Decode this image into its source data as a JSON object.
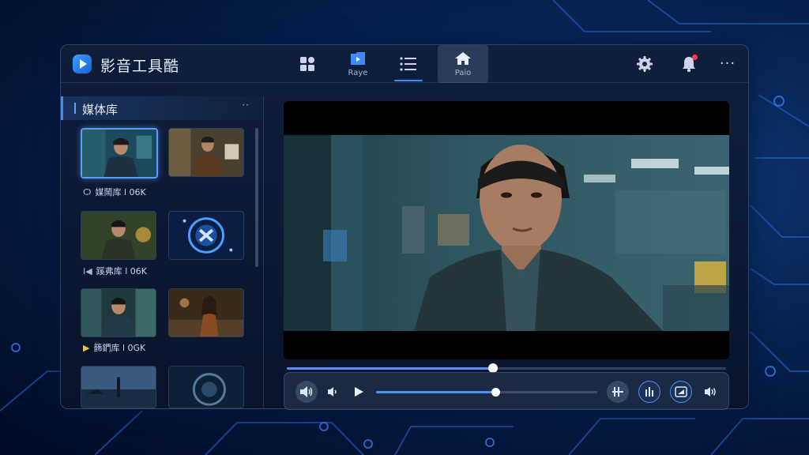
{
  "app": {
    "title": "影音工具酷"
  },
  "nav": [
    {
      "id": "grid",
      "label": ""
    },
    {
      "id": "player",
      "label": "Raye"
    },
    {
      "id": "list",
      "label": ""
    },
    {
      "id": "home",
      "label": "Paio"
    }
  ],
  "icons": {
    "settings": "gear-icon",
    "notifications": "bell-icon",
    "more": "more-icon",
    "more_glyph": "···"
  },
  "library": {
    "title": "媒体库",
    "more": "··",
    "items": [
      {
        "caption": "",
        "selected": true
      },
      {
        "caption": "",
        "selected": false
      },
      {
        "caption": "",
        "selected": false
      },
      {
        "caption": "",
        "selected": false
      },
      {
        "caption": "",
        "selected": false
      },
      {
        "caption": "",
        "selected": false
      },
      {
        "caption": "",
        "selected": false
      },
      {
        "caption": "",
        "selected": false
      }
    ],
    "captions": [
      {
        "icon": "Ѻ",
        "text": "媒鬧库 l 06K"
      },
      {
        "icon": "Ⅰ◀",
        "text": "蹊弗库 l 06K"
      },
      {
        "icon": "▶",
        "text": "籂鍆库 l 0GK"
      }
    ]
  },
  "playback": {
    "progress": 0.47,
    "volume": 0.54,
    "accent": "#4a90ff"
  }
}
